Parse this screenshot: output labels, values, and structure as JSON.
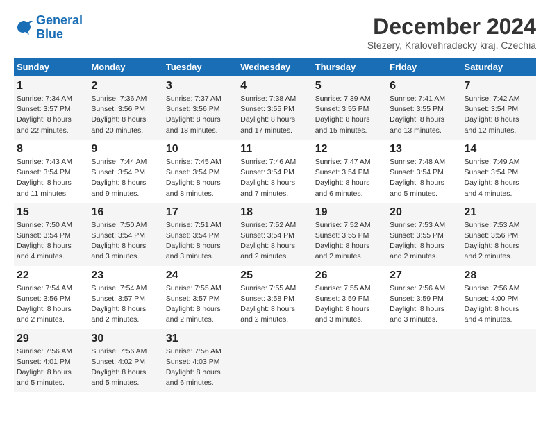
{
  "header": {
    "logo_line1": "General",
    "logo_line2": "Blue",
    "month_title": "December 2024",
    "location": "Stezery, Kralovehradecky kraj, Czechia"
  },
  "days_of_week": [
    "Sunday",
    "Monday",
    "Tuesday",
    "Wednesday",
    "Thursday",
    "Friday",
    "Saturday"
  ],
  "weeks": [
    [
      {
        "day": "1",
        "info": "Sunrise: 7:34 AM\nSunset: 3:57 PM\nDaylight: 8 hours\nand 22 minutes."
      },
      {
        "day": "2",
        "info": "Sunrise: 7:36 AM\nSunset: 3:56 PM\nDaylight: 8 hours\nand 20 minutes."
      },
      {
        "day": "3",
        "info": "Sunrise: 7:37 AM\nSunset: 3:56 PM\nDaylight: 8 hours\nand 18 minutes."
      },
      {
        "day": "4",
        "info": "Sunrise: 7:38 AM\nSunset: 3:55 PM\nDaylight: 8 hours\nand 17 minutes."
      },
      {
        "day": "5",
        "info": "Sunrise: 7:39 AM\nSunset: 3:55 PM\nDaylight: 8 hours\nand 15 minutes."
      },
      {
        "day": "6",
        "info": "Sunrise: 7:41 AM\nSunset: 3:55 PM\nDaylight: 8 hours\nand 13 minutes."
      },
      {
        "day": "7",
        "info": "Sunrise: 7:42 AM\nSunset: 3:54 PM\nDaylight: 8 hours\nand 12 minutes."
      }
    ],
    [
      {
        "day": "8",
        "info": "Sunrise: 7:43 AM\nSunset: 3:54 PM\nDaylight: 8 hours\nand 11 minutes."
      },
      {
        "day": "9",
        "info": "Sunrise: 7:44 AM\nSunset: 3:54 PM\nDaylight: 8 hours\nand 9 minutes."
      },
      {
        "day": "10",
        "info": "Sunrise: 7:45 AM\nSunset: 3:54 PM\nDaylight: 8 hours\nand 8 minutes."
      },
      {
        "day": "11",
        "info": "Sunrise: 7:46 AM\nSunset: 3:54 PM\nDaylight: 8 hours\nand 7 minutes."
      },
      {
        "day": "12",
        "info": "Sunrise: 7:47 AM\nSunset: 3:54 PM\nDaylight: 8 hours\nand 6 minutes."
      },
      {
        "day": "13",
        "info": "Sunrise: 7:48 AM\nSunset: 3:54 PM\nDaylight: 8 hours\nand 5 minutes."
      },
      {
        "day": "14",
        "info": "Sunrise: 7:49 AM\nSunset: 3:54 PM\nDaylight: 8 hours\nand 4 minutes."
      }
    ],
    [
      {
        "day": "15",
        "info": "Sunrise: 7:50 AM\nSunset: 3:54 PM\nDaylight: 8 hours\nand 4 minutes."
      },
      {
        "day": "16",
        "info": "Sunrise: 7:50 AM\nSunset: 3:54 PM\nDaylight: 8 hours\nand 3 minutes."
      },
      {
        "day": "17",
        "info": "Sunrise: 7:51 AM\nSunset: 3:54 PM\nDaylight: 8 hours\nand 3 minutes."
      },
      {
        "day": "18",
        "info": "Sunrise: 7:52 AM\nSunset: 3:54 PM\nDaylight: 8 hours\nand 2 minutes."
      },
      {
        "day": "19",
        "info": "Sunrise: 7:52 AM\nSunset: 3:55 PM\nDaylight: 8 hours\nand 2 minutes."
      },
      {
        "day": "20",
        "info": "Sunrise: 7:53 AM\nSunset: 3:55 PM\nDaylight: 8 hours\nand 2 minutes."
      },
      {
        "day": "21",
        "info": "Sunrise: 7:53 AM\nSunset: 3:56 PM\nDaylight: 8 hours\nand 2 minutes."
      }
    ],
    [
      {
        "day": "22",
        "info": "Sunrise: 7:54 AM\nSunset: 3:56 PM\nDaylight: 8 hours\nand 2 minutes."
      },
      {
        "day": "23",
        "info": "Sunrise: 7:54 AM\nSunset: 3:57 PM\nDaylight: 8 hours\nand 2 minutes."
      },
      {
        "day": "24",
        "info": "Sunrise: 7:55 AM\nSunset: 3:57 PM\nDaylight: 8 hours\nand 2 minutes."
      },
      {
        "day": "25",
        "info": "Sunrise: 7:55 AM\nSunset: 3:58 PM\nDaylight: 8 hours\nand 2 minutes."
      },
      {
        "day": "26",
        "info": "Sunrise: 7:55 AM\nSunset: 3:59 PM\nDaylight: 8 hours\nand 3 minutes."
      },
      {
        "day": "27",
        "info": "Sunrise: 7:56 AM\nSunset: 3:59 PM\nDaylight: 8 hours\nand 3 minutes."
      },
      {
        "day": "28",
        "info": "Sunrise: 7:56 AM\nSunset: 4:00 PM\nDaylight: 8 hours\nand 4 minutes."
      }
    ],
    [
      {
        "day": "29",
        "info": "Sunrise: 7:56 AM\nSunset: 4:01 PM\nDaylight: 8 hours\nand 5 minutes."
      },
      {
        "day": "30",
        "info": "Sunrise: 7:56 AM\nSunset: 4:02 PM\nDaylight: 8 hours\nand 5 minutes."
      },
      {
        "day": "31",
        "info": "Sunrise: 7:56 AM\nSunset: 4:03 PM\nDaylight: 8 hours\nand 6 minutes."
      },
      {
        "day": "",
        "info": ""
      },
      {
        "day": "",
        "info": ""
      },
      {
        "day": "",
        "info": ""
      },
      {
        "day": "",
        "info": ""
      }
    ]
  ]
}
